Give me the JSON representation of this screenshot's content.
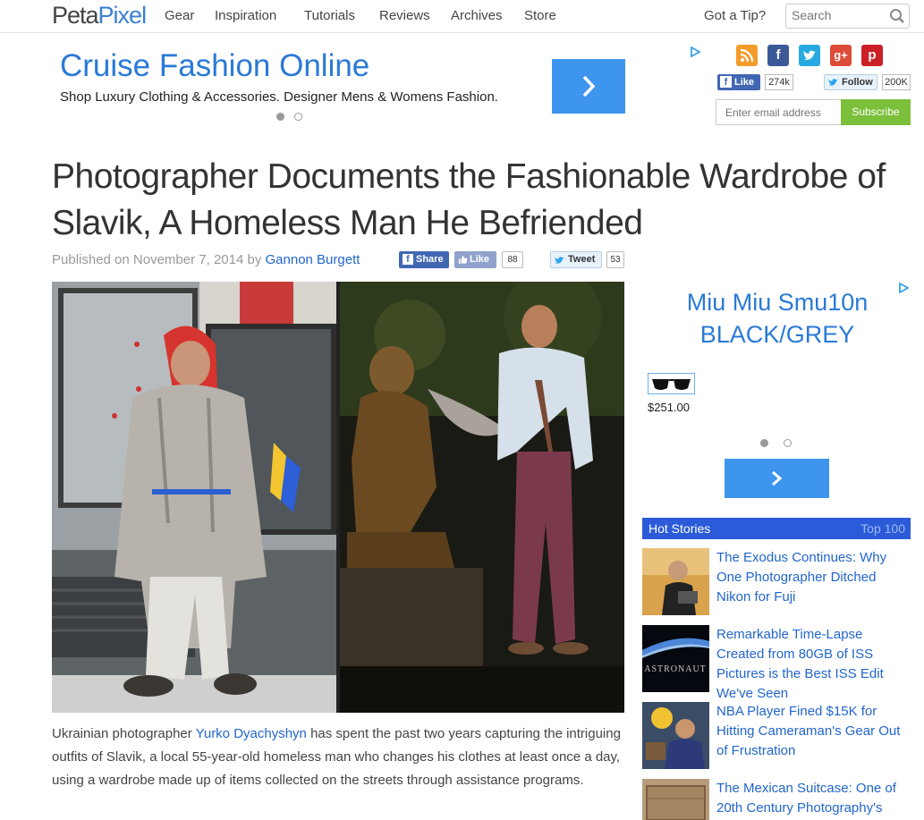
{
  "header": {
    "logo_part1": "Peta",
    "logo_part2": "Pixel",
    "nav": [
      "Gear",
      "Inspiration",
      "Tutorials",
      "Reviews",
      "Archives",
      "Store"
    ],
    "tip": "Got a Tip?",
    "search_placeholder": "Search"
  },
  "top_ad": {
    "title": "Cruise Fashion Online",
    "subtitle": "Shop Luxury Clothing & Accessories. Designer Mens & Womens Fashion."
  },
  "social": {
    "icons": [
      "rss-icon",
      "facebook-icon",
      "twitter-icon",
      "google-plus-icon",
      "pinterest-icon"
    ],
    "like_label": "Like",
    "like_count": "274k",
    "follow_label": "Follow",
    "follow_count": "200K",
    "email_placeholder": "Enter email address",
    "subscribe_label": "Subscribe"
  },
  "article": {
    "headline": "Photographer Documents the Fashionable Wardrobe of Slavik, A Homeless Man He Befriended",
    "published_prefix": "Published on November 7, 2014 by",
    "author": "Gannon Burgett",
    "share_label": "Share",
    "like_label": "Like",
    "like_count": "88",
    "tweet_label": "Tweet",
    "tweet_count": "53",
    "body_before": "Ukrainian photographer ",
    "body_link": "Yurko Dyachyshyn",
    "body_after": " has spent the past two years capturing the intriguing outfits of Slavik, a local 55-year-old homeless man who changes his clothes at least once a day, using a wardrobe made up of items collected on the streets through assistance programs."
  },
  "side_ad": {
    "title_line1": "Miu Miu Smu10n",
    "title_line2": "BLACK/GREY",
    "price": "$251.00"
  },
  "hot_stories": {
    "title": "Hot Stories",
    "top_link": "Top 100",
    "items": [
      "The Exodus Continues: Why One Photographer Ditched Nikon for Fuji",
      "Remarkable Time-Lapse Created from 80GB of ISS Pictures is the Best ISS Edit We've Seen",
      "NBA Player Fined $15K for Hitting Cameraman's Gear Out of Frustration",
      "The Mexican Suitcase: One of 20th Century Photography's"
    ],
    "thumb2_text": "ASTRONAUT"
  },
  "colors": {
    "accent_blue": "#2a7ad6",
    "hot_header": "#2b5bd9",
    "subscribe_green": "#7cbf3a"
  }
}
